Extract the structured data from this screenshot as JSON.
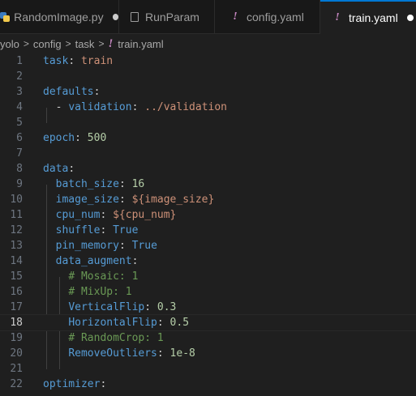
{
  "tabs": [
    {
      "label": "RandomImage.py",
      "icon": "python-icon",
      "modified": true,
      "active": false
    },
    {
      "label": "RunParam",
      "icon": "file-icon",
      "modified": false,
      "active": false
    },
    {
      "label": "config.yaml",
      "icon": "yaml-icon",
      "modified": false,
      "active": false
    },
    {
      "label": "train.yaml",
      "icon": "yaml-icon",
      "modified": true,
      "active": true
    }
  ],
  "breadcrumb": {
    "items": [
      "yolo",
      "config",
      "task",
      "train.yaml"
    ],
    "separator": ">"
  },
  "editor": {
    "current_line": 18,
    "lines": [
      {
        "num": "1",
        "tokens": [
          {
            "t": "task",
            "c": "k"
          },
          {
            "t": ": ",
            "c": "p"
          },
          {
            "t": "train",
            "c": "s"
          }
        ]
      },
      {
        "num": "2",
        "tokens": []
      },
      {
        "num": "3",
        "tokens": [
          {
            "t": "defaults",
            "c": "k"
          },
          {
            "t": ":",
            "c": "p"
          }
        ]
      },
      {
        "num": "4",
        "tokens": [
          {
            "t": "  - ",
            "c": "p"
          },
          {
            "t": "validation",
            "c": "k"
          },
          {
            "t": ": ",
            "c": "p"
          },
          {
            "t": "../validation",
            "c": "s"
          }
        ]
      },
      {
        "num": "5",
        "tokens": []
      },
      {
        "num": "6",
        "tokens": [
          {
            "t": "epoch",
            "c": "k"
          },
          {
            "t": ": ",
            "c": "p"
          },
          {
            "t": "500",
            "c": "n"
          }
        ]
      },
      {
        "num": "7",
        "tokens": []
      },
      {
        "num": "8",
        "tokens": [
          {
            "t": "data",
            "c": "k"
          },
          {
            "t": ":",
            "c": "p"
          }
        ]
      },
      {
        "num": "9",
        "tokens": [
          {
            "t": "  ",
            "c": "p"
          },
          {
            "t": "batch_size",
            "c": "k"
          },
          {
            "t": ": ",
            "c": "p"
          },
          {
            "t": "16",
            "c": "n"
          }
        ]
      },
      {
        "num": "10",
        "tokens": [
          {
            "t": "  ",
            "c": "p"
          },
          {
            "t": "image_size",
            "c": "k"
          },
          {
            "t": ": ",
            "c": "p"
          },
          {
            "t": "${image_size}",
            "c": "s"
          }
        ]
      },
      {
        "num": "11",
        "tokens": [
          {
            "t": "  ",
            "c": "p"
          },
          {
            "t": "cpu_num",
            "c": "k"
          },
          {
            "t": ": ",
            "c": "p"
          },
          {
            "t": "${cpu_num}",
            "c": "s"
          }
        ]
      },
      {
        "num": "12",
        "tokens": [
          {
            "t": "  ",
            "c": "p"
          },
          {
            "t": "shuffle",
            "c": "k"
          },
          {
            "t": ": ",
            "c": "p"
          },
          {
            "t": "True",
            "c": "k"
          }
        ]
      },
      {
        "num": "13",
        "tokens": [
          {
            "t": "  ",
            "c": "p"
          },
          {
            "t": "pin_memory",
            "c": "k"
          },
          {
            "t": ": ",
            "c": "p"
          },
          {
            "t": "True",
            "c": "k"
          }
        ]
      },
      {
        "num": "14",
        "tokens": [
          {
            "t": "  ",
            "c": "p"
          },
          {
            "t": "data_augment",
            "c": "k"
          },
          {
            "t": ":",
            "c": "p"
          }
        ]
      },
      {
        "num": "15",
        "tokens": [
          {
            "t": "    ",
            "c": "p"
          },
          {
            "t": "# Mosaic: 1",
            "c": "c"
          }
        ]
      },
      {
        "num": "16",
        "tokens": [
          {
            "t": "    ",
            "c": "p"
          },
          {
            "t": "# MixUp: 1",
            "c": "c"
          }
        ]
      },
      {
        "num": "17",
        "tokens": [
          {
            "t": "    ",
            "c": "p"
          },
          {
            "t": "VerticalFlip",
            "c": "k"
          },
          {
            "t": ": ",
            "c": "p"
          },
          {
            "t": "0.3",
            "c": "n"
          }
        ]
      },
      {
        "num": "18",
        "tokens": [
          {
            "t": "    ",
            "c": "p"
          },
          {
            "t": "HorizontalFlip",
            "c": "k"
          },
          {
            "t": ": ",
            "c": "p"
          },
          {
            "t": "0.5",
            "c": "n"
          }
        ]
      },
      {
        "num": "19",
        "tokens": [
          {
            "t": "    ",
            "c": "p"
          },
          {
            "t": "# RandomCrop: 1",
            "c": "c"
          }
        ]
      },
      {
        "num": "20",
        "tokens": [
          {
            "t": "    ",
            "c": "p"
          },
          {
            "t": "RemoveOutliers",
            "c": "k"
          },
          {
            "t": ": ",
            "c": "p"
          },
          {
            "t": "1e-8",
            "c": "n"
          }
        ]
      },
      {
        "num": "21",
        "tokens": []
      },
      {
        "num": "22",
        "tokens": [
          {
            "t": "optimizer",
            "c": "k"
          },
          {
            "t": ":",
            "c": "p"
          }
        ]
      }
    ]
  },
  "colors": {
    "background": "#1f1f1f",
    "key": "#569cd6",
    "string": "#ce9178",
    "number": "#b5cea8",
    "comment": "#6a9955",
    "accent": "#0078d4",
    "yaml_icon": "#c586c0"
  }
}
